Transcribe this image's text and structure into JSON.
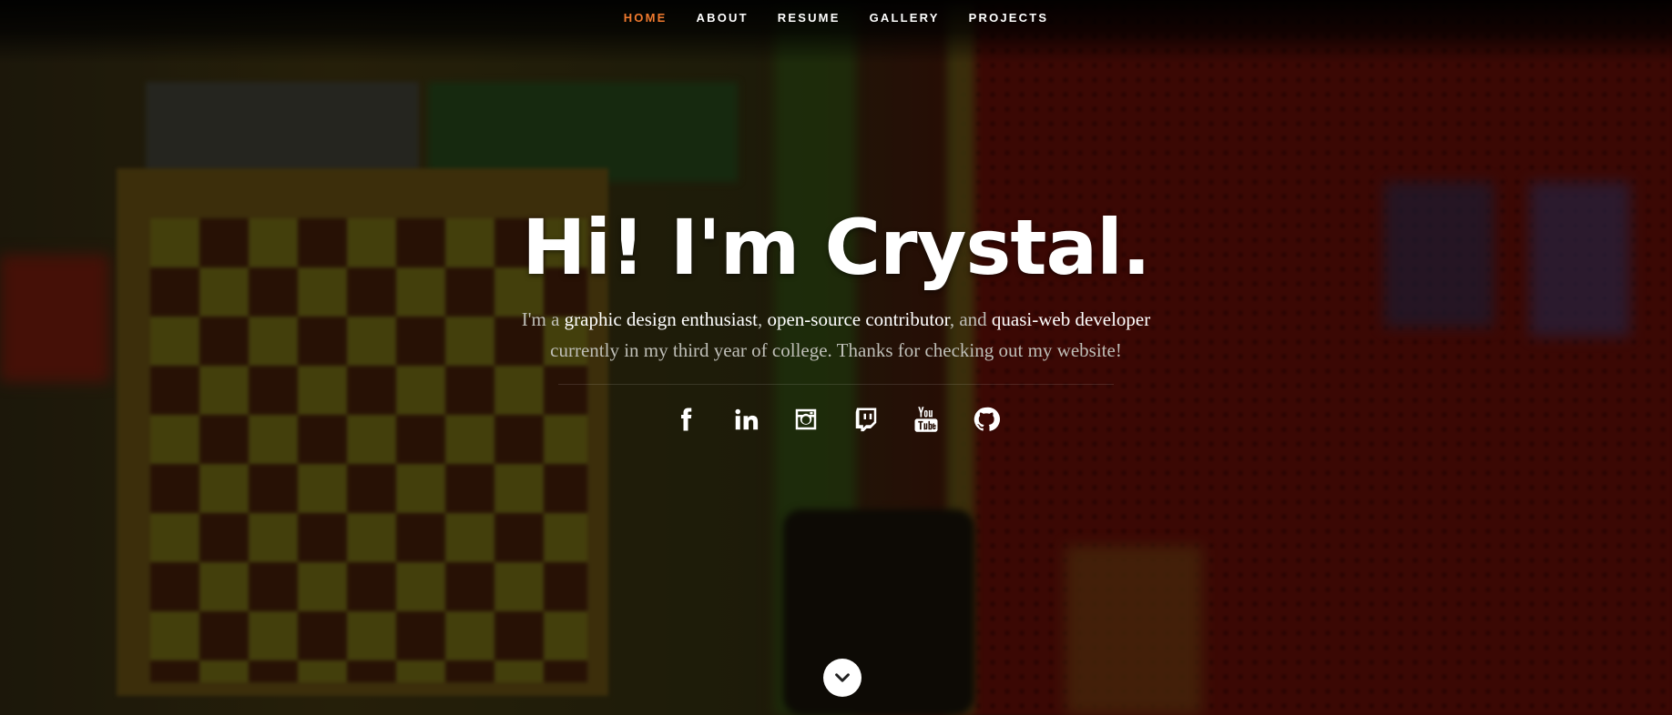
{
  "nav": {
    "items": [
      {
        "label": "HOME",
        "active": true
      },
      {
        "label": "ABOUT",
        "active": false
      },
      {
        "label": "RESUME",
        "active": false
      },
      {
        "label": "GALLERY",
        "active": false
      },
      {
        "label": "PROJECTS",
        "active": false
      }
    ]
  },
  "hero": {
    "title": "Hi! I'm Crystal.",
    "intro": {
      "p1": "I'm a ",
      "b1": "graphic design enthusiast",
      "p2": ", ",
      "b2": "open-source contributor",
      "p3": ", and ",
      "b3": "quasi-web developer",
      "p4": " currently in my third year of college. Thanks for checking out my website!"
    }
  },
  "social": [
    {
      "icon": "facebook-icon"
    },
    {
      "icon": "linkedin-icon"
    },
    {
      "icon": "instagram-icon"
    },
    {
      "icon": "twitch-icon"
    },
    {
      "icon": "youtube-icon"
    },
    {
      "icon": "github-icon"
    }
  ],
  "scroll": {
    "icon": "chevron-down-icon"
  },
  "colors": {
    "accent": "#f07a2e",
    "text": "#ffffff",
    "muted": "#bfbfb8"
  }
}
